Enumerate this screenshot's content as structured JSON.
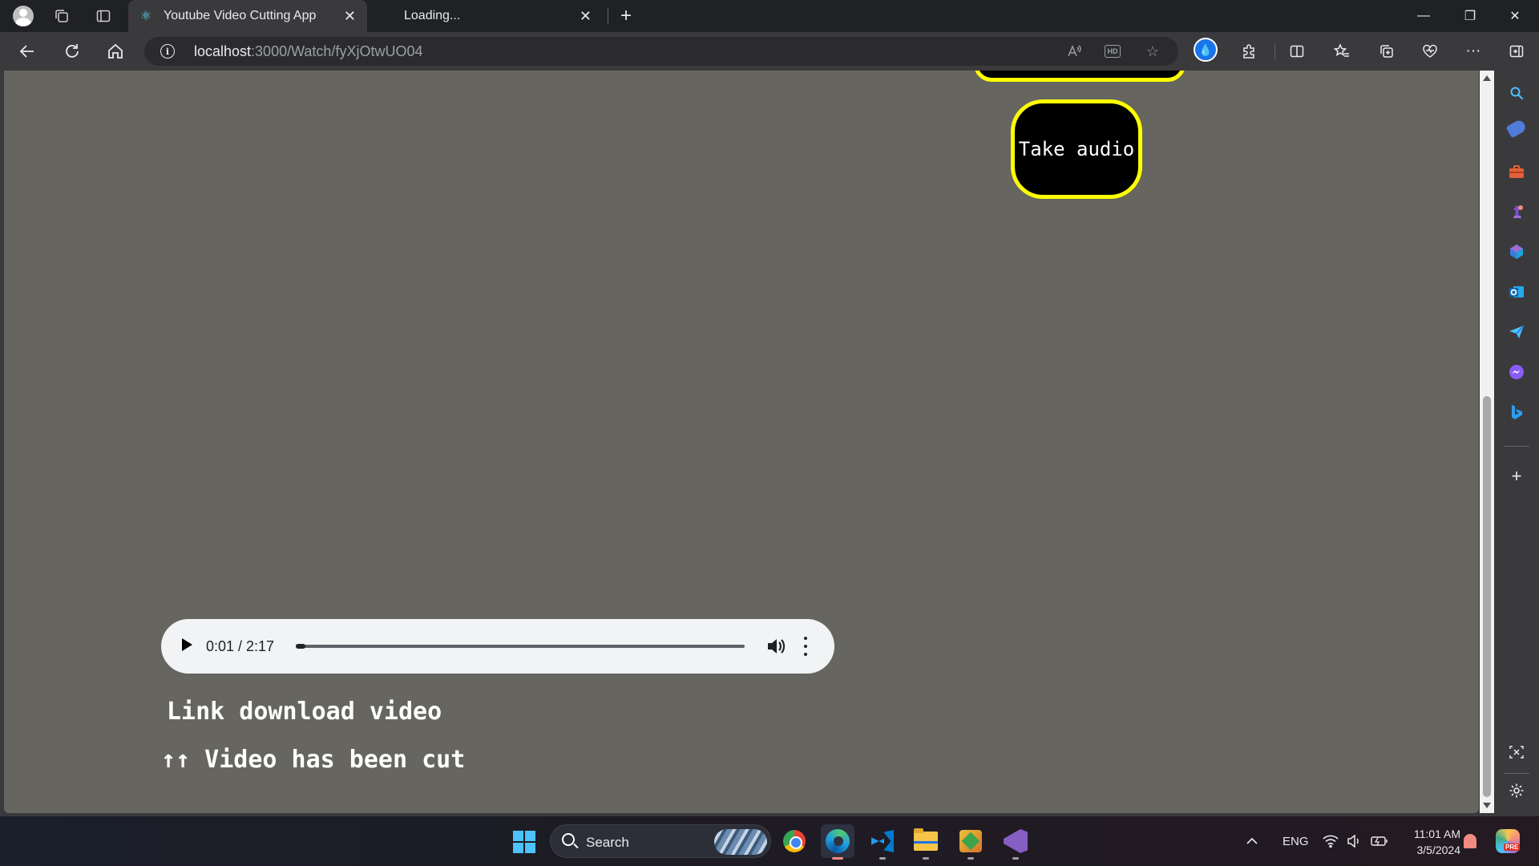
{
  "browser": {
    "tabs": [
      {
        "label": "Youtube Video Cutting App",
        "favicon": "react-icon",
        "active": true
      },
      {
        "label": "Loading...",
        "active": false
      }
    ],
    "address": {
      "host": "localhost",
      "path": ":3000/Watch/fyXjOtwUO04"
    },
    "tab_close_glyph": "✕",
    "new_tab_glyph": "+",
    "window_controls": {
      "minimize": "—",
      "restore": "❐",
      "close": "✕"
    }
  },
  "page": {
    "button_take_audio": "Take audio",
    "audio_player": {
      "time": "0:01 / 2:17",
      "progress": 0.008
    },
    "link_text": "Link download video",
    "status_text": "↑↑ Video has been cut",
    "colors": {
      "page_bg": "#666560",
      "button_border": "#ffff00",
      "button_bg": "#000000"
    }
  },
  "taskbar": {
    "search_label": "Search",
    "language": "ENG",
    "time": "11:01 AM",
    "date": "3/5/2024",
    "copilot_badge": "PRE"
  }
}
